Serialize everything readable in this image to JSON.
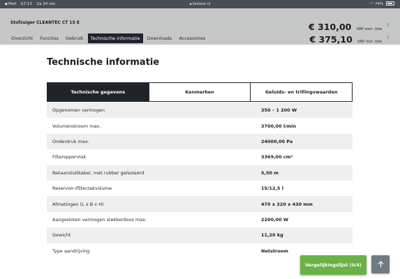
{
  "statusbar": {
    "back": "◀ Mail",
    "time": "07:13",
    "date": "Za 24 okt.",
    "url": "festool.nl",
    "battery": "74%"
  },
  "header": {
    "product": "Stofzuiger CLEANTEC CT 15 E",
    "nav": [
      "Overzicht",
      "Functies",
      "Gebruik",
      "Technische informatie",
      "Downloads",
      "Accessoires"
    ],
    "active_nav": 3,
    "price_excl": "€ 310,00",
    "price_excl_label": "VAP excl. btw",
    "price_incl": "€ 375,10",
    "price_incl_label": "VAP incl. btw",
    "footnote": "1"
  },
  "main": {
    "title": "Technische informatie",
    "tabs": [
      "Technische gegevens",
      "Kenmerken",
      "Geluids- en trillingswaarden"
    ],
    "active_tab": 0,
    "rows": [
      {
        "k": "Opgenomen vermogen",
        "v": "350 – 1 200 W"
      },
      {
        "k": "Volumenstroom max.",
        "v": "3700,00 l/min"
      },
      {
        "k": "Onderdruk max.",
        "v": "24000,00 Pa"
      },
      {
        "k": "Filteroppervlak",
        "v": "3369,00 cm²"
      },
      {
        "k": "Netaansluitkabel, met rubber geïsoleerd",
        "v": "5,50 m"
      },
      {
        "k": "Reservoir-/filterzakvolume",
        "v": "15/12,5 l"
      },
      {
        "k": "Afmetingen (L x B x H)",
        "v": "470 x 320 x 430 mm"
      },
      {
        "k": "Aangesloten vermogen stekkerdoos max.",
        "v": "2200,00 W"
      },
      {
        "k": "Gewicht",
        "v": "11,20 kg"
      },
      {
        "k": "Type aandrijving",
        "v": "Netstroom"
      }
    ]
  },
  "compare": {
    "label": "Vergelijkingslijst (0/4)"
  },
  "icons": {
    "to_top": "arrow-up-icon",
    "lock": "lock-icon",
    "wifi": "wifi-icon",
    "battery": "battery-icon"
  },
  "colors": {
    "accent_dark": "#1f232c",
    "green": "#6ab246",
    "header_bg": "#c6c7c7"
  }
}
